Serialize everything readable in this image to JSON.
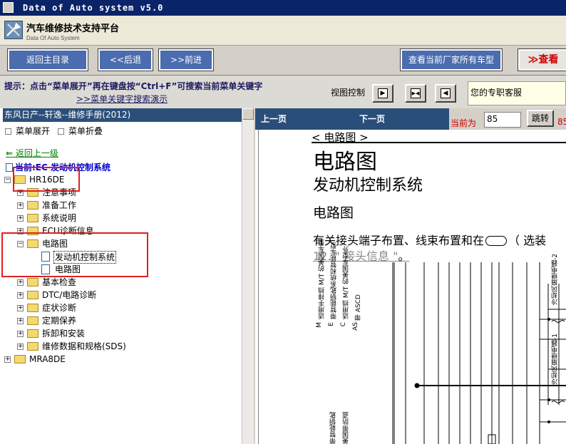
{
  "window": {
    "title": "Data of Auto system v5.0"
  },
  "header": {
    "title": "汽车维修技术支持平台",
    "subtitle": "Data Of Auto System"
  },
  "toolbar": {
    "back_main": "返回主目录",
    "back": "<<后退",
    "forward": ">>前进",
    "view_all_models": "查看当前厂家所有车型",
    "view_more": "≫查看"
  },
  "hint": {
    "text": "提示：点击“菜单展开”再在键盘按“Ctrl+F”可搜索当前菜单关键字",
    "link": ">>菜单关键字搜索演示",
    "view_control": "视图控制",
    "service": "您的专职客服"
  },
  "left": {
    "heading": "东风日产--轩逸--维修手册(2012)",
    "expand": "菜单展开",
    "collapse": "菜单折叠",
    "back_up": "返回上一级",
    "current": "当前:EC 发动机控制系统",
    "tree": {
      "hr16de": "HR16DE",
      "notes": "注意事项",
      "prep": "准备工作",
      "sysdesc": "系统说明",
      "ecu": "ECU诊断信息",
      "wiring": "电路图",
      "engctl": "发动机控制系统",
      "wiringdiag": "电路图",
      "basic": "基本检查",
      "dtc": "DTC/电路诊断",
      "symptom": "症状诊断",
      "maint": "定期保养",
      "removal": "拆卸和安装",
      "sds": "维修数据和规格(SDS)",
      "mra8de": "MRA8DE"
    }
  },
  "right": {
    "prev": "上一页",
    "next": "下一页",
    "current_label": "当前为",
    "page_value": "85",
    "jump": "跳转",
    "page_trail": "85",
    "doc": {
      "breadcrumb": "< 电路图 >",
      "h1": "电路图",
      "h2": "发动机控制系统",
      "h3": "电路图",
      "para_a": "有关接头端子布置、线束布置和在",
      "para_b": "（ 选装",
      "link": "12. \" 接头信息 \"",
      "link_end": "。",
      "legend": [
        {
          "code": "M",
          "text": "适用手排挡 M/T 的美国车型"
        },
        {
          "code": "E",
          "text": "带智能钥匙系统和智能车型"
        },
        {
          "code": "C",
          "text": "适用挡 M/T 的美国车型外"
        },
        {
          "code": "AS",
          "text": "带 ASCD"
        }
      ],
      "relays": [
        "冷却风扇继电器-2",
        "冷却风扇继电器-1"
      ],
      "bottom_texts": [
        "带智能钥匙",
        "美国带防盗"
      ]
    }
  }
}
